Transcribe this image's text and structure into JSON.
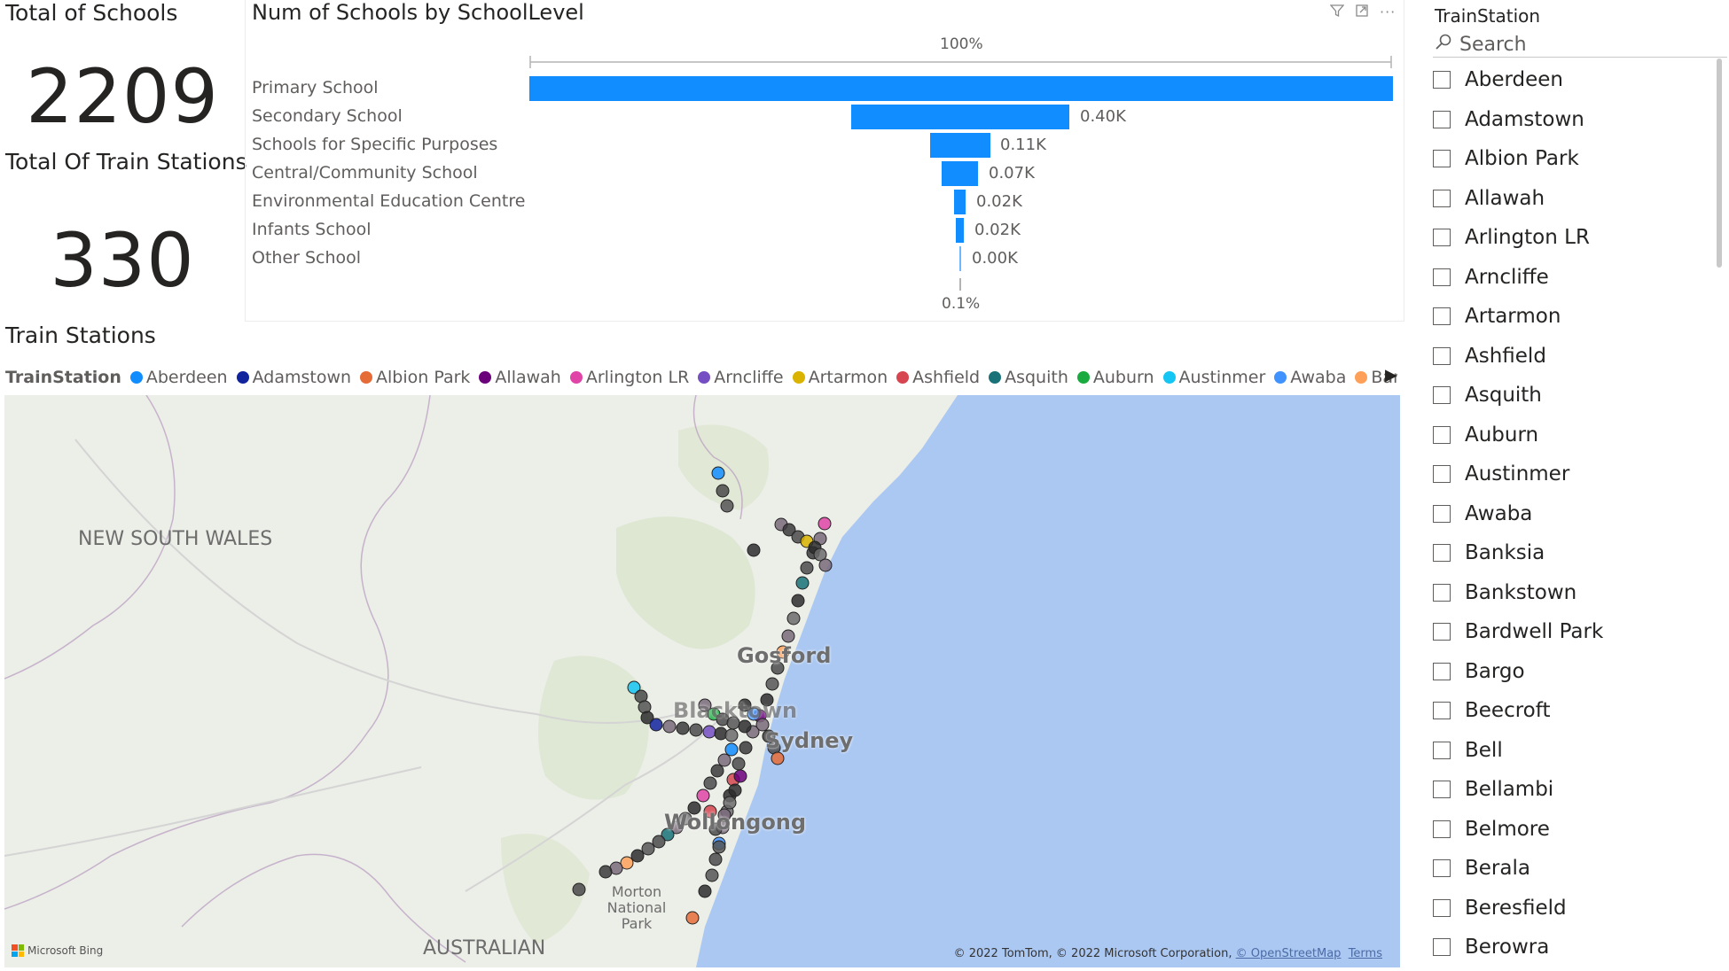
{
  "cards": {
    "schools_title": "Total of Schools",
    "schools_value": "2209",
    "stations_title": "Total Of Train Stations",
    "stations_value": "330"
  },
  "funnel": {
    "title": "Num of Schools by SchoolLevel",
    "top_pct": "100%",
    "bottom_pct": "0.1%",
    "bar_color": "#118dff",
    "rows": [
      {
        "label": "Primary School",
        "value_label": ""
      },
      {
        "label": "Secondary School",
        "value_label": "0.40K"
      },
      {
        "label": "Schools for Specific Purposes",
        "value_label": "0.11K"
      },
      {
        "label": "Central/Community School",
        "value_label": "0.07K"
      },
      {
        "label": "Environmental Education Centre",
        "value_label": "0.02K"
      },
      {
        "label": "Infants School",
        "value_label": "0.02K"
      },
      {
        "label": "Other School",
        "value_label": "0.00K"
      }
    ]
  },
  "map_visual": {
    "title": "Train Stations",
    "legend_title": "TrainStation",
    "legend": [
      {
        "name": "Aberdeen",
        "color": "#118dff"
      },
      {
        "name": "Adamstown",
        "color": "#12239e"
      },
      {
        "name": "Albion Park",
        "color": "#e66c37"
      },
      {
        "name": "Allawah",
        "color": "#6b007b"
      },
      {
        "name": "Arlington LR",
        "color": "#e044a7"
      },
      {
        "name": "Arncliffe",
        "color": "#744ec2"
      },
      {
        "name": "Artarmon",
        "color": "#d9b300"
      },
      {
        "name": "Ashfield",
        "color": "#d64550"
      },
      {
        "name": "Asquith",
        "color": "#197278"
      },
      {
        "name": "Auburn",
        "color": "#1aab40"
      },
      {
        "name": "Austinmer",
        "color": "#15c6f4"
      },
      {
        "name": "Awaba",
        "color": "#4092ff"
      },
      {
        "name": "Banksia",
        "color": "#ffa058"
      }
    ],
    "labels": {
      "region": "NEW SOUTH WALES",
      "gosford": "Gosford",
      "blacktown": "Blacktown",
      "sydney": "Sydney",
      "wollongong": "Wollongong",
      "morton": "Morton National Park",
      "australian": "AUSTRALIAN"
    },
    "attribution": "© 2022 TomTom, © 2022 Microsoft Corporation,",
    "osm_link": "© OpenStreetMap",
    "terms_link": "Terms",
    "bing": "Microsoft Bing"
  },
  "slicer": {
    "title": "TrainStation",
    "search_placeholder": "Search",
    "items": [
      "Aberdeen",
      "Adamstown",
      "Albion Park",
      "Allawah",
      "Arlington LR",
      "Arncliffe",
      "Artarmon",
      "Ashfield",
      "Asquith",
      "Auburn",
      "Austinmer",
      "Awaba",
      "Banksia",
      "Bankstown",
      "Bardwell Park",
      "Bargo",
      "Beecroft",
      "Bell",
      "Bellambi",
      "Belmore",
      "Berala",
      "Beresfield",
      "Berowra"
    ]
  }
}
